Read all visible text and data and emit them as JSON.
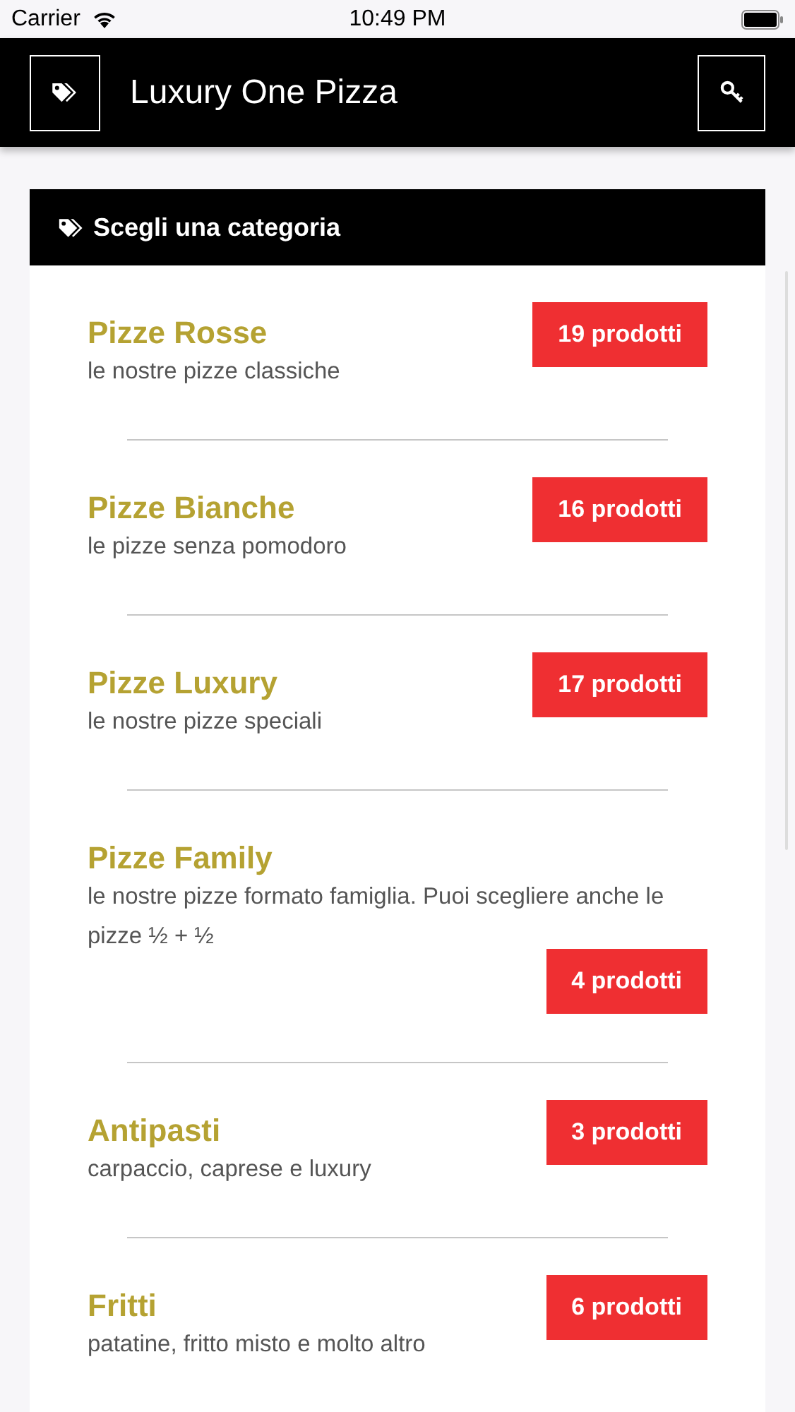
{
  "status_bar": {
    "carrier": "Carrier",
    "time": "10:49 PM"
  },
  "header": {
    "title": "Luxury One Pizza"
  },
  "panel": {
    "title": "Scegli una categoria"
  },
  "categories": [
    {
      "name": "Pizze Rosse",
      "description": "le nostre pizze classiche",
      "count": "19 prodotti"
    },
    {
      "name": "Pizze Bianche",
      "description": "le pizze senza pomodoro",
      "count": "16 prodotti"
    },
    {
      "name": "Pizze Luxury",
      "description": "le nostre pizze speciali",
      "count": "17 prodotti"
    },
    {
      "name": "Pizze Family",
      "description": "le nostre pizze formato famiglia. Puoi scegliere anche le pizze ½ + ½",
      "count": "4 prodotti"
    },
    {
      "name": "Antipasti",
      "description": "carpaccio, caprese e luxury",
      "count": "3 prodotti"
    },
    {
      "name": "Fritti",
      "description": "patatine, fritto misto e molto altro",
      "count": "6 prodotti"
    }
  ]
}
